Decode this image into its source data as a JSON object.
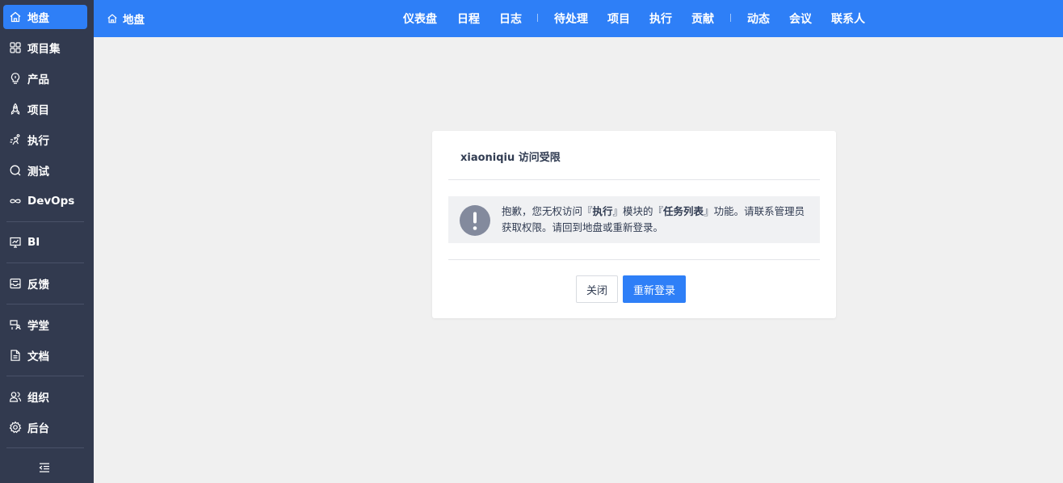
{
  "sidebar": {
    "items": [
      {
        "label": "地盘",
        "icon": "home-icon",
        "active": true
      },
      {
        "label": "项目集",
        "icon": "grid-icon"
      },
      {
        "label": "产品",
        "icon": "lightbulb-icon"
      },
      {
        "label": "项目",
        "icon": "rocket-icon"
      },
      {
        "label": "执行",
        "icon": "run-icon"
      },
      {
        "label": "测试",
        "icon": "magnifier-icon"
      },
      {
        "label": "DevOps",
        "icon": "infinity-icon"
      },
      {
        "label": "BI",
        "icon": "chart-board-icon"
      },
      {
        "label": "反馈",
        "icon": "inbox-icon"
      },
      {
        "label": "学堂",
        "icon": "school-icon"
      },
      {
        "label": "文档",
        "icon": "document-icon"
      },
      {
        "label": "组织",
        "icon": "users-icon"
      },
      {
        "label": "后台",
        "icon": "gear-icon"
      }
    ],
    "collapse_icon": "collapse-menu-icon"
  },
  "topbar": {
    "breadcrumb": "地盘",
    "menu": [
      "仪表盘",
      "日程",
      "日志",
      "待处理",
      "项目",
      "执行",
      "贡献",
      "动态",
      "会议",
      "联系人"
    ]
  },
  "modal": {
    "title": "xiaoniqiu 访问受限",
    "message_part1": "抱歉，您无权访问『",
    "module_name": "执行",
    "message_part2": "』模块的『",
    "function_name": "任务列表",
    "message_part3": "』功能。请联系管理员获取权限。请回到地盘或重新登录。",
    "close_label": "关闭",
    "relogin_label": "重新登录"
  },
  "colors": {
    "accent": "#2e7ff7",
    "sidebar_bg": "#323a4f",
    "page_bg": "#f0f0f0",
    "alert_icon": "#838a9d"
  }
}
